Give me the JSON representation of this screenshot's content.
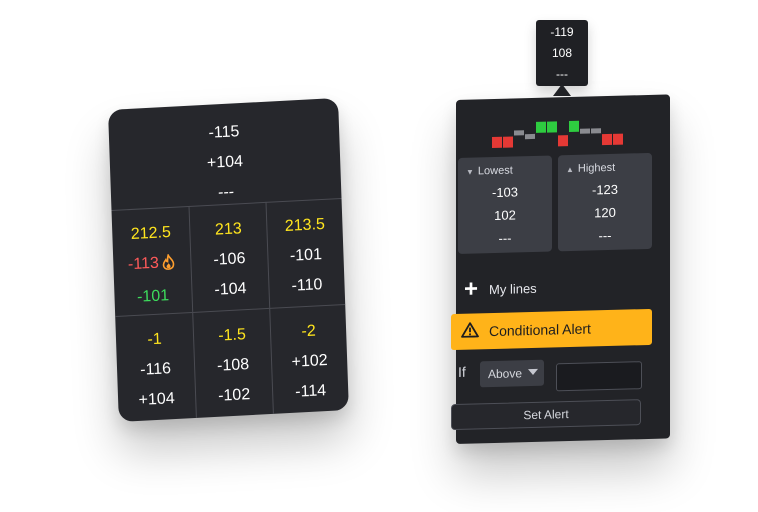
{
  "left_card": {
    "header": [
      "-115",
      "+104",
      "---"
    ],
    "cells": [
      {
        "values": [
          {
            "text": "212.5",
            "color": "yellow"
          },
          {
            "text": "-113",
            "color": "red",
            "icon": "flame-icon"
          },
          {
            "text": "-101",
            "color": "green"
          }
        ]
      },
      {
        "values": [
          {
            "text": "213",
            "color": "yellow"
          },
          {
            "text": "-106",
            "color": "white"
          },
          {
            "text": "-104",
            "color": "white"
          }
        ]
      },
      {
        "values": [
          {
            "text": "213.5",
            "color": "yellow"
          },
          {
            "text": "-101",
            "color": "white"
          },
          {
            "text": "-110",
            "color": "white"
          }
        ]
      },
      {
        "values": [
          {
            "text": "-1",
            "color": "yellow"
          },
          {
            "text": "-116",
            "color": "white"
          },
          {
            "text": "+104",
            "color": "white"
          }
        ]
      },
      {
        "values": [
          {
            "text": "-1.5",
            "color": "yellow"
          },
          {
            "text": "-108",
            "color": "white"
          },
          {
            "text": "-102",
            "color": "white"
          }
        ]
      },
      {
        "values": [
          {
            "text": "-2",
            "color": "yellow"
          },
          {
            "text": "+102",
            "color": "white"
          },
          {
            "text": "-114",
            "color": "white"
          }
        ]
      }
    ]
  },
  "tooltip": [
    "-119",
    "108",
    "---"
  ],
  "right_panel": {
    "bars": [
      {
        "color": "#e53935",
        "dir": "down"
      },
      {
        "color": "#e53935",
        "dir": "down"
      },
      {
        "color": "#8a8b90",
        "dir": "up-small"
      },
      {
        "color": "#8a8b90",
        "dir": "down-small"
      },
      {
        "color": "#2ecc40",
        "dir": "up"
      },
      {
        "color": "#2ecc40",
        "dir": "up"
      },
      {
        "color": "#e53935",
        "dir": "down"
      },
      {
        "color": "#2ecc40",
        "dir": "up"
      },
      {
        "color": "#8a8b90",
        "dir": "up-small"
      },
      {
        "color": "#8a8b90",
        "dir": "up-small"
      },
      {
        "color": "#e53935",
        "dir": "down"
      },
      {
        "color": "#e53935",
        "dir": "down"
      }
    ],
    "lowest": {
      "title": "Lowest",
      "values": [
        "-103",
        "102",
        "---"
      ]
    },
    "highest": {
      "title": "Highest",
      "values": [
        "-123",
        "120",
        "---"
      ]
    },
    "my_lines_label": "My lines",
    "alert_title": "Conditional Alert",
    "if_label": "If",
    "condition_selected": "Above",
    "threshold_value": "",
    "set_alert_label": "Set Alert"
  },
  "colors": {
    "yellow": "#ffe51e",
    "red": "#ff5a5a",
    "green": "#3ddc5c",
    "accent": "#ffb319",
    "panel": "#222327"
  },
  "icons": {
    "flame": "flame-icon",
    "warning": "warning-icon",
    "plus": "plus-icon",
    "caret": "caret-down-icon",
    "triangle_down": "triangle-down-icon",
    "triangle_up": "triangle-up-icon"
  }
}
